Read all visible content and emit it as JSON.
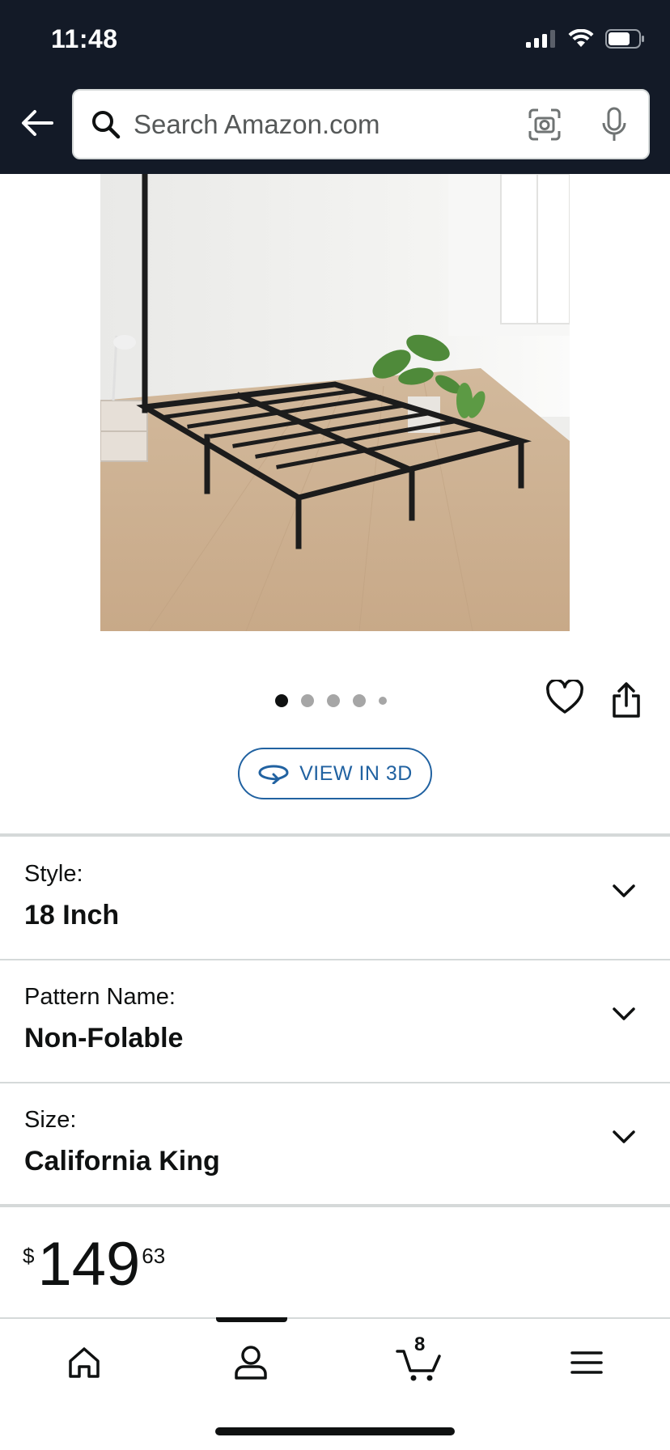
{
  "status_bar": {
    "time": "11:48",
    "icons": [
      "signal-icon",
      "wifi-icon",
      "battery-icon"
    ]
  },
  "header": {
    "back_icon": "arrow-left-icon",
    "search": {
      "placeholder": "Search Amazon.com",
      "value": "",
      "icons": [
        "search-icon",
        "camera-icon",
        "mic-icon"
      ]
    }
  },
  "product": {
    "image_alt": "Black metal platform bed frame",
    "carousel": {
      "total": 5,
      "active_index": 0
    },
    "actions": [
      "heart-icon",
      "share-icon"
    ],
    "view_in_3d_label": "VIEW IN 3D"
  },
  "variations": [
    {
      "label": "Style:",
      "value": "18 Inch"
    },
    {
      "label": "Pattern Name:",
      "value": "Non-Folable"
    },
    {
      "label": "Size:",
      "value": "California King"
    }
  ],
  "price": {
    "symbol": "$",
    "whole": "149",
    "fraction": "63"
  },
  "tabbar": {
    "tabs": [
      "home-icon",
      "account-icon",
      "cart-icon",
      "menu-icon"
    ],
    "active_index": 1,
    "cart_count": "8"
  },
  "colors": {
    "header_bg": "#131a27",
    "link_blue": "#2162a1",
    "divider": "#d5d9d9",
    "text": "#0f1111"
  }
}
